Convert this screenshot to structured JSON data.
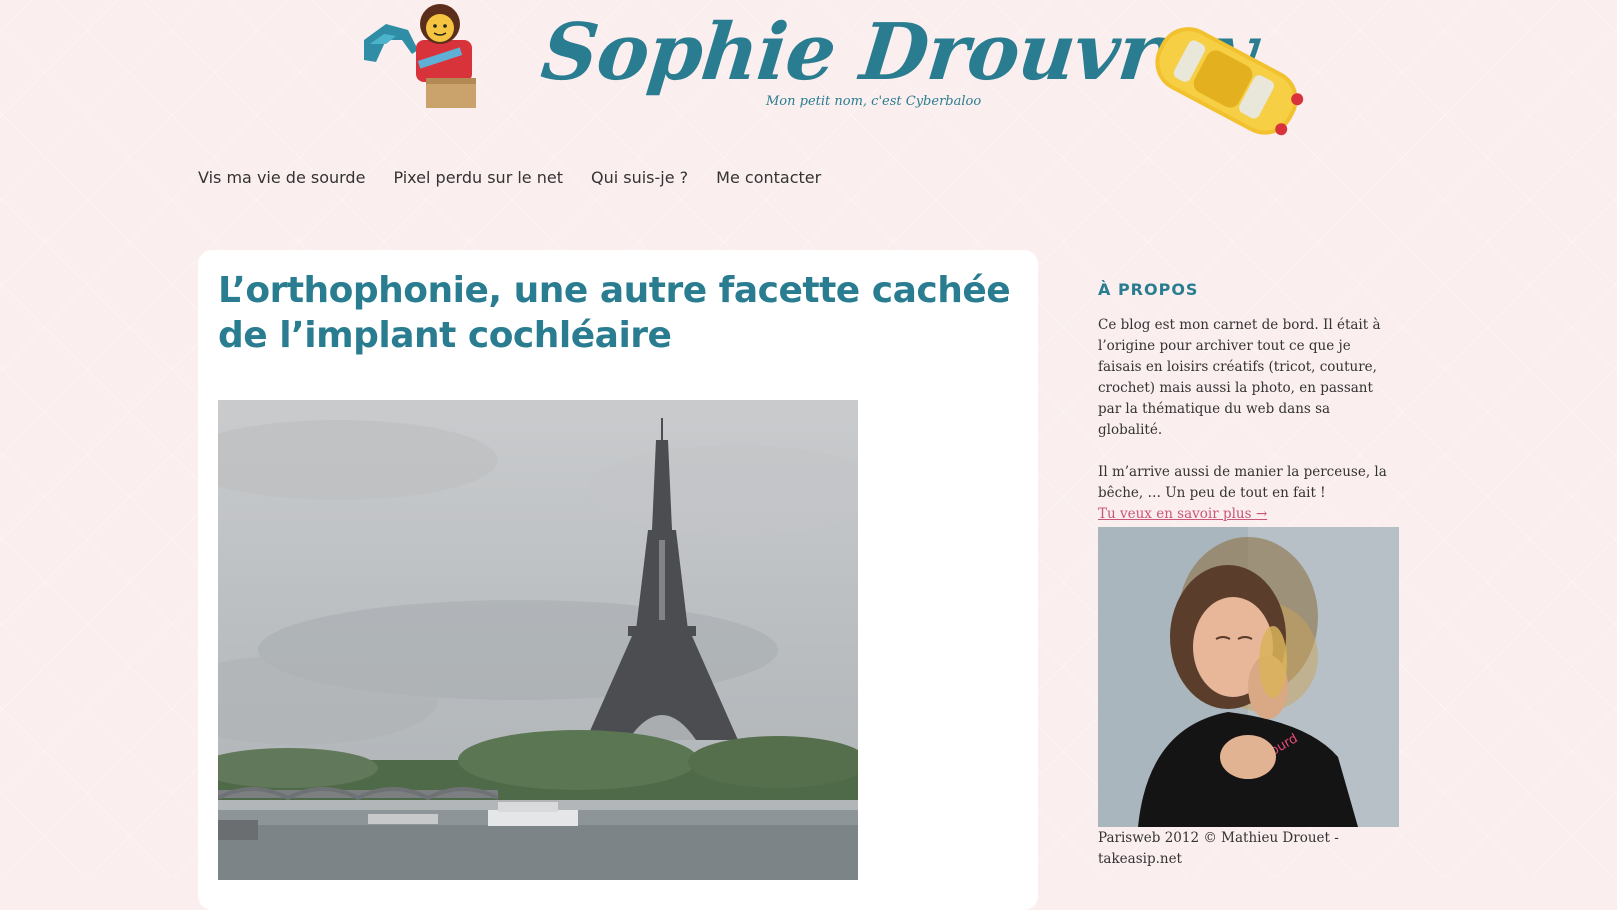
{
  "header": {
    "site_title": "Sophie Drouvroy",
    "tagline": "Mon petit nom, c'est Cyberbaloo"
  },
  "nav": {
    "items": [
      {
        "label": "Vis ma vie de sourde"
      },
      {
        "label": "Pixel perdu sur le net"
      },
      {
        "label": "Qui suis-je ?"
      },
      {
        "label": "Me contacter"
      }
    ]
  },
  "article": {
    "title": "L’orthophonie, une autre facette cachée de l’implant cochléaire"
  },
  "sidebar": {
    "about_title": "À PROPOS",
    "about_text_1": "Ce blog est mon carnet de bord. Il était à l’origine pour archiver tout ce que je faisais en loisirs créatifs (tricot, couture, crochet) mais aussi la photo, en passant par la thématique du web dans sa globalité.",
    "about_text_2": "Il m’arrive aussi de manier la perceuse, la bêche, … Un peu de tout en fait !",
    "more_link": "Tu veux en savoir plus →",
    "photo_shirt_text": "desourd",
    "photo_caption": "Parisweb 2012 © Mathieu Drouet - takeasip.net"
  },
  "colors": {
    "accent": "#2a7d90",
    "link": "#c8557a",
    "background": "#fbeeee"
  }
}
